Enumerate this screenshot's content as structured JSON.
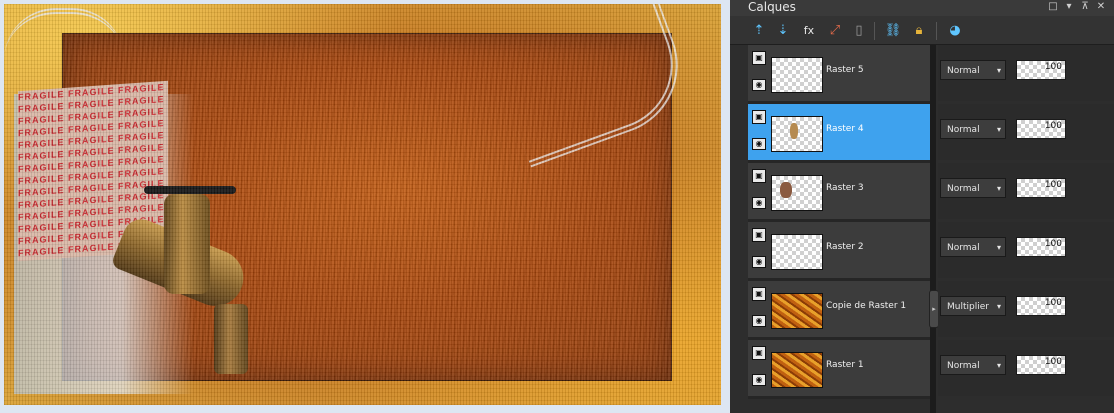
{
  "panel": {
    "title": "Calques",
    "controls": [
      "□",
      "▾",
      "⊼",
      "✕"
    ]
  },
  "toolbar": {
    "icons": [
      "new-raster-layer-icon",
      "new-vector-layer-icon",
      "fx-effects-icon",
      "mask-icon",
      "delete-layer-icon",
      "link-icon",
      "lock-icon",
      "visibility-toggle-icon"
    ]
  },
  "layers": [
    {
      "name": "Raster 5",
      "blend": "Normal",
      "opacity": "100",
      "selected": false
    },
    {
      "name": "Raster 4",
      "blend": "Normal",
      "opacity": "100",
      "selected": true
    },
    {
      "name": "Raster 3",
      "blend": "Normal",
      "opacity": "100",
      "selected": false
    },
    {
      "name": "Raster 2",
      "blend": "Normal",
      "opacity": "100",
      "selected": false
    },
    {
      "name": "Copie de Raster 1",
      "blend": "Multiplier",
      "opacity": "100",
      "selected": false
    },
    {
      "name": "Raster 1",
      "blend": "Normal",
      "opacity": "100",
      "selected": false
    }
  ],
  "canvas": {
    "fragile_text": "FRAGILE FRAGILE FRAGILE"
  },
  "colors": {
    "selection": "#3ea2ee",
    "panel_bg": "#2d2d2d",
    "accent": "#5fc6ff"
  }
}
